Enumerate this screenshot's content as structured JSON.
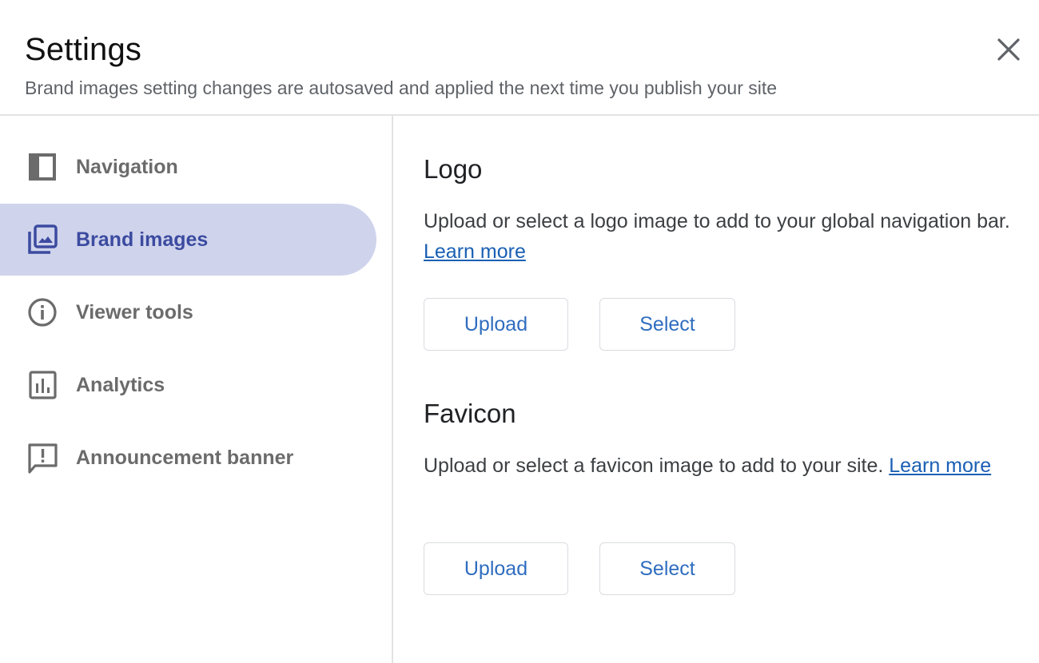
{
  "header": {
    "title": "Settings",
    "subtitle": "Brand images setting changes are autosaved and applied the next time you publish your site",
    "close_icon": "close-icon"
  },
  "sidebar": {
    "active_index": 1,
    "items": [
      {
        "label": "Navigation",
        "icon": "navigation-panel-icon"
      },
      {
        "label": "Brand images",
        "icon": "photo-library-icon"
      },
      {
        "label": "Viewer tools",
        "icon": "info-icon"
      },
      {
        "label": "Analytics",
        "icon": "bar-chart-icon"
      },
      {
        "label": "Announcement banner",
        "icon": "feedback-icon"
      }
    ]
  },
  "colors": {
    "accent": "#3c4ba0",
    "active_background": "#cfd4ec",
    "link": "#1a5fb4",
    "button_text": "#2f6dbf",
    "nav_text": "#6b6b6b"
  },
  "sections": {
    "logo": {
      "title": "Logo",
      "description": "Upload or select a logo image to add to your global navigation bar.",
      "link": "Learn more",
      "upload_label": "Upload",
      "select_label": "Select"
    },
    "favicon": {
      "title": "Favicon",
      "description": "Upload or select a favicon image to add to your site.",
      "link": "Learn more",
      "upload_label": "Upload",
      "select_label": "Select"
    }
  }
}
